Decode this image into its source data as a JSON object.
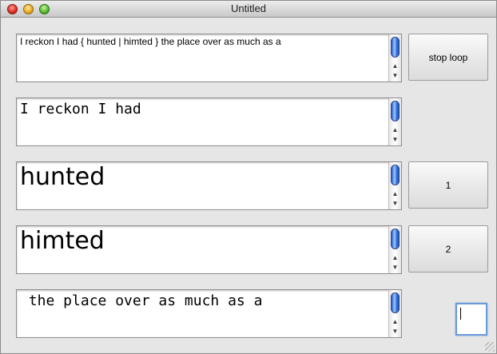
{
  "window": {
    "title": "Untitled"
  },
  "fields": [
    {
      "text": "I reckon I had { hunted | himted } the place over as much as a"
    },
    {
      "text": "I reckon I had"
    },
    {
      "text": "hunted"
    },
    {
      "text": "himted"
    },
    {
      "text": " the place over as much as a"
    }
  ],
  "buttons": {
    "stop_loop": "stop loop",
    "option1": "1",
    "option2": "2"
  },
  "small_input": {
    "value": ""
  },
  "scroll_arrows": {
    "up": "▲",
    "down": "▼"
  }
}
